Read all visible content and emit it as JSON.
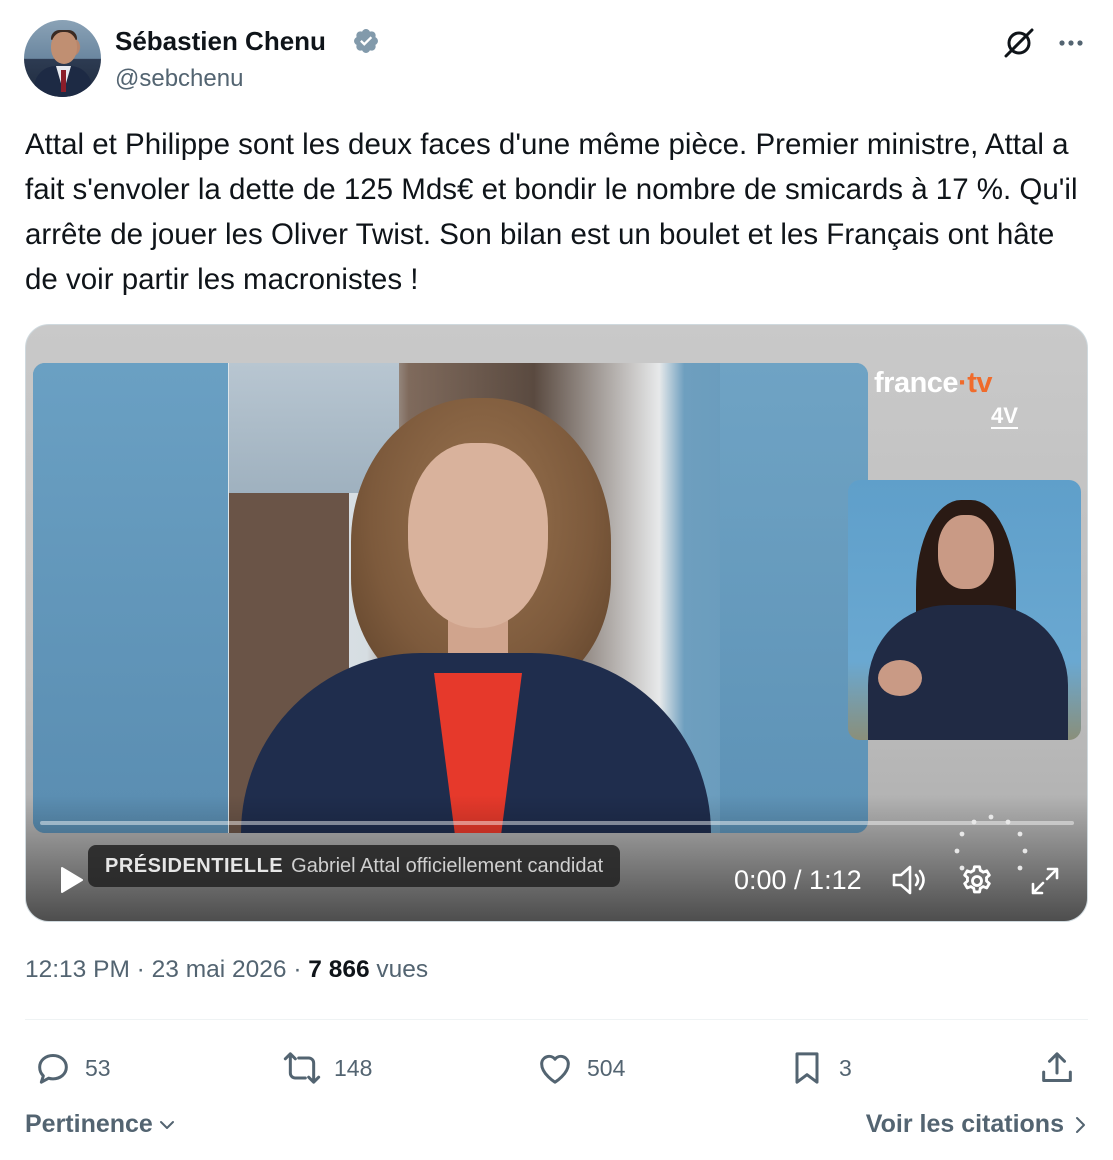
{
  "author": {
    "name": "Sébastien Chenu",
    "handle": "@sebchenu",
    "verified": true
  },
  "tweet": {
    "text": "Attal et Philippe sont les deux faces d'une même pièce. Premier ministre, Attal a fait s'envoler la dette de 125 Mds€ et bondir le nombre de smicards à 17 %. Qu'il arrête de jouer les Oliver Twist. Son bilan est un boulet et les Français ont hâte de voir partir les macronistes !"
  },
  "video": {
    "channel_brand": "france",
    "channel_brand_suffix": "·tv",
    "channel_sub": "4V",
    "ticker_tag": "PRÉSIDENTIELLE",
    "ticker_headline": "Gabriel Attal officiellement candidat",
    "time_display": "0:00 / 1:12",
    "progress": 0.0
  },
  "meta": {
    "time": "12:13 PM",
    "separator": " · ",
    "date": "23 mai 2026",
    "views_count": "7 866",
    "views_label": "vues"
  },
  "actions": {
    "replies": "53",
    "reposts": "148",
    "likes": "504",
    "bookmarks": "3"
  },
  "footer": {
    "sort_label": "Pertinence",
    "quotes_label": "Voir les citations"
  },
  "colors": {
    "text_primary": "#0f1419",
    "text_secondary": "#536471",
    "verified_blue": "#829aab",
    "divider": "#eff3f4"
  }
}
